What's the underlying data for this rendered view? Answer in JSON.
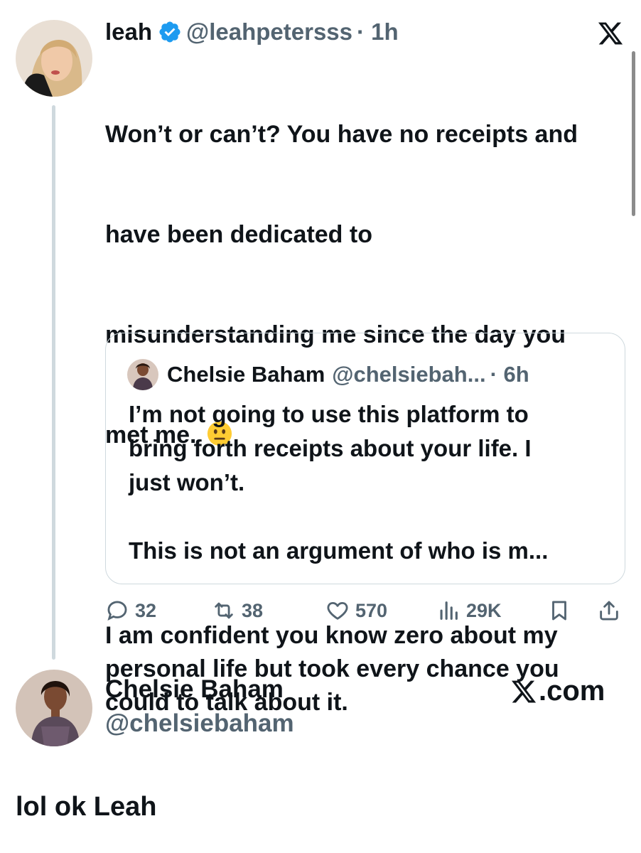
{
  "tweet": {
    "author_name": "leah",
    "author_handle": "@leahpetersss",
    "separator_time": "· 1h",
    "text_lines": [
      "Won’t or can’t? You have no receipts and",
      "have been dedicated to",
      "misunderstanding me since the day you",
      "met me."
    ],
    "text_para2": "I am confident you know zero about my\npersonal life but took every chance you\ncould to talk about it.",
    "emoji": "neutral-face-emoji"
  },
  "quote": {
    "author_name": "Chelsie Baham",
    "author_handle": "@chelsiebah...",
    "time": "· 6h",
    "text": "I’m not going to use this platform to\nbring forth receipts about your life. I\njust won’t.\n\nThis is not an argument of who is m..."
  },
  "actions": {
    "replies": "32",
    "reposts": "38",
    "likes": "570",
    "views": "29K"
  },
  "reply_author": {
    "name": "Chelsie Baham",
    "handle": "@chelsiebaham",
    "site": ".com"
  },
  "caption": "lol ok Leah",
  "colors": {
    "verified_blue": "#1d9bf0",
    "muted_text": "#536471",
    "border": "#cfd9de"
  }
}
